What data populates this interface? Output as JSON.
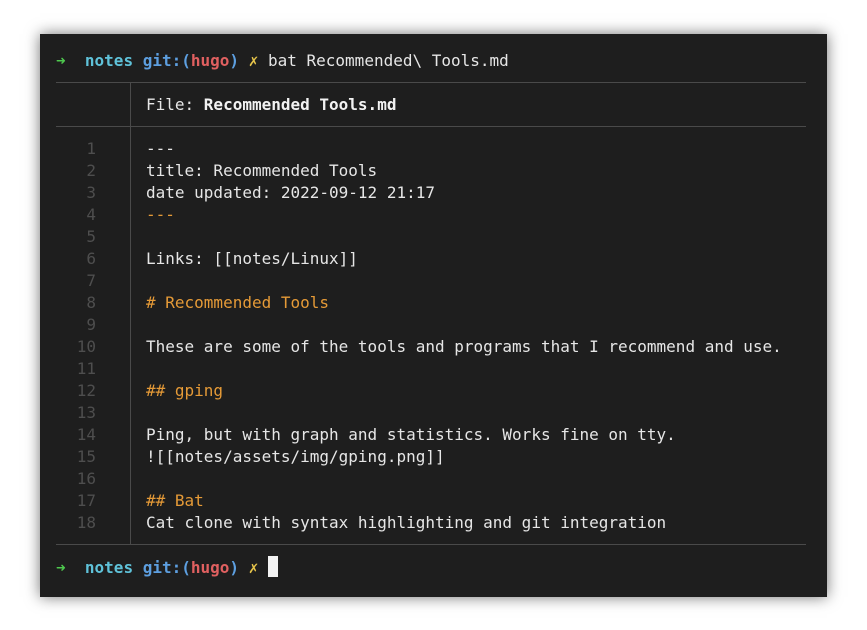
{
  "prompt_top": {
    "arrow": "➜",
    "dir": "notes",
    "git_label": "git:(",
    "branch": "hugo",
    "git_close": ")",
    "dirty": "✗",
    "command": "bat Recommended\\ Tools.md"
  },
  "file_header": {
    "label": "File: ",
    "filename": "Recommended Tools.md"
  },
  "lines": [
    {
      "num": "1",
      "text": "---",
      "style": "plain"
    },
    {
      "num": "2",
      "text": "title: Recommended Tools",
      "style": "plain"
    },
    {
      "num": "3",
      "text": "date updated: 2022-09-12 21:17",
      "style": "plain"
    },
    {
      "num": "4",
      "text": "---",
      "style": "orange"
    },
    {
      "num": "5",
      "text": "",
      "style": "plain"
    },
    {
      "num": "6",
      "text": "Links: [[notes/Linux]]",
      "style": "plain"
    },
    {
      "num": "7",
      "text": "",
      "style": "plain"
    },
    {
      "num": "8",
      "text": "# Recommended Tools",
      "style": "orange"
    },
    {
      "num": "9",
      "text": "",
      "style": "plain"
    },
    {
      "num": "10",
      "text": "These are some of the tools and programs that I recommend and use.",
      "style": "plain"
    },
    {
      "num": "11",
      "text": "",
      "style": "plain"
    },
    {
      "num": "12",
      "text": "## gping",
      "style": "orange"
    },
    {
      "num": "13",
      "text": "",
      "style": "plain"
    },
    {
      "num": "14",
      "text": "Ping, but with graph and statistics. Works fine on tty.",
      "style": "plain"
    },
    {
      "num": "15",
      "text": "![[notes/assets/img/gping.png]]",
      "style": "plain"
    },
    {
      "num": "16",
      "text": "",
      "style": "plain"
    },
    {
      "num": "17",
      "text": "## Bat",
      "style": "orange"
    },
    {
      "num": "18",
      "text": "Cat clone with syntax highlighting and git integration",
      "style": "plain"
    }
  ],
  "prompt_bottom": {
    "arrow": "➜",
    "dir": "notes",
    "git_label": "git:(",
    "branch": "hugo",
    "git_close": ")",
    "dirty": "✗",
    "command": ""
  },
  "colors": {
    "background": "#1e1e1e",
    "text": "#e6e6e6",
    "arrow": "#4ec94e",
    "dir": "#5fc2d9",
    "git": "#5d9fe0",
    "branch": "#e06060",
    "dirty": "#e6c44a",
    "markdown_heading": "#e59a37",
    "line_number": "#4e4e4e"
  }
}
